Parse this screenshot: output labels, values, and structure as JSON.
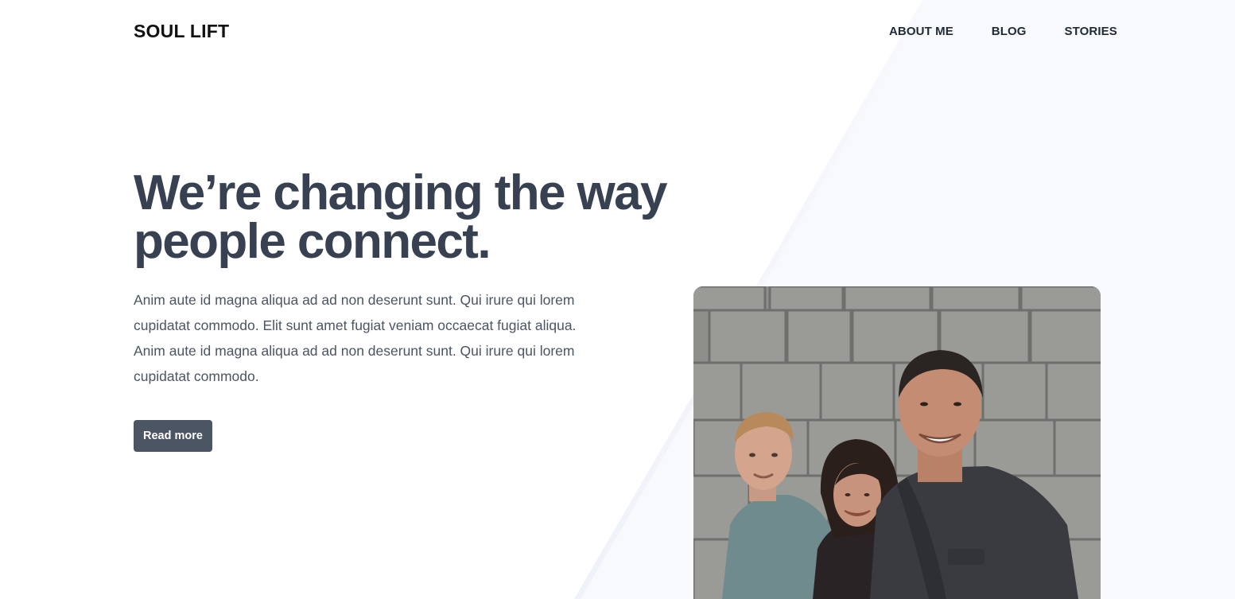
{
  "brand": {
    "name": "SOUL LIFT"
  },
  "nav": {
    "items": [
      {
        "label": "ABOUT ME"
      },
      {
        "label": "BLOG"
      },
      {
        "label": "STORIES"
      }
    ]
  },
  "hero": {
    "heading_line1": "We’re changing the way",
    "heading_line2": "people connect.",
    "body": "Anim aute id magna aliqua ad ad non deserunt sunt. Qui irure qui lorem cupidatat commodo. Elit sunt amet fugiat veniam occaecat fugiat aliqua. Anim aute id magna aliqua ad ad non deserunt sunt. Qui irure qui lorem cupidatat commodo.",
    "cta_label": "Read more"
  },
  "colors": {
    "heading": "#374151",
    "button_bg": "#4b5563",
    "shape_bg": "#f8f9fd"
  }
}
